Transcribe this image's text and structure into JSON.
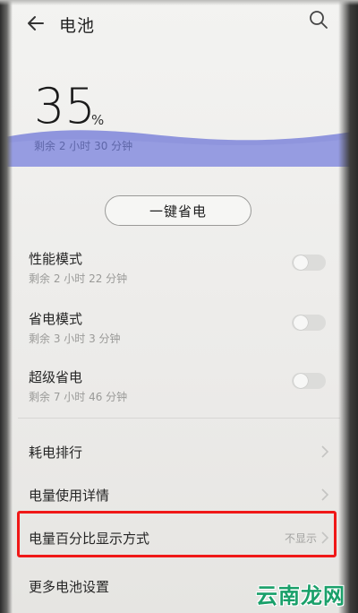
{
  "header": {
    "title": "电池"
  },
  "battery": {
    "percent": "35",
    "unit": "%",
    "remaining": "剩余 2 小时 30 分钟"
  },
  "quick_save": {
    "label": "一键省电"
  },
  "modes": [
    {
      "title": "性能模式",
      "remaining": "剩余 2 小时 22 分钟",
      "enabled": false
    },
    {
      "title": "省电模式",
      "remaining": "剩余 3 小时 3 分钟",
      "enabled": false
    },
    {
      "title": "超级省电",
      "remaining": "剩余 7 小时 46 分钟",
      "enabled": false
    }
  ],
  "list": [
    {
      "label": "耗电排行",
      "value": ""
    },
    {
      "label": "电量使用详情",
      "value": ""
    },
    {
      "label": "电量百分比显示方式",
      "value": "不显示"
    },
    {
      "label": "更多电池设置",
      "value": ""
    }
  ],
  "watermark": "云南龙网",
  "colors": {
    "wave": "#8f95dd",
    "highlight": "#f01818",
    "watermark": "#1aa06a"
  }
}
